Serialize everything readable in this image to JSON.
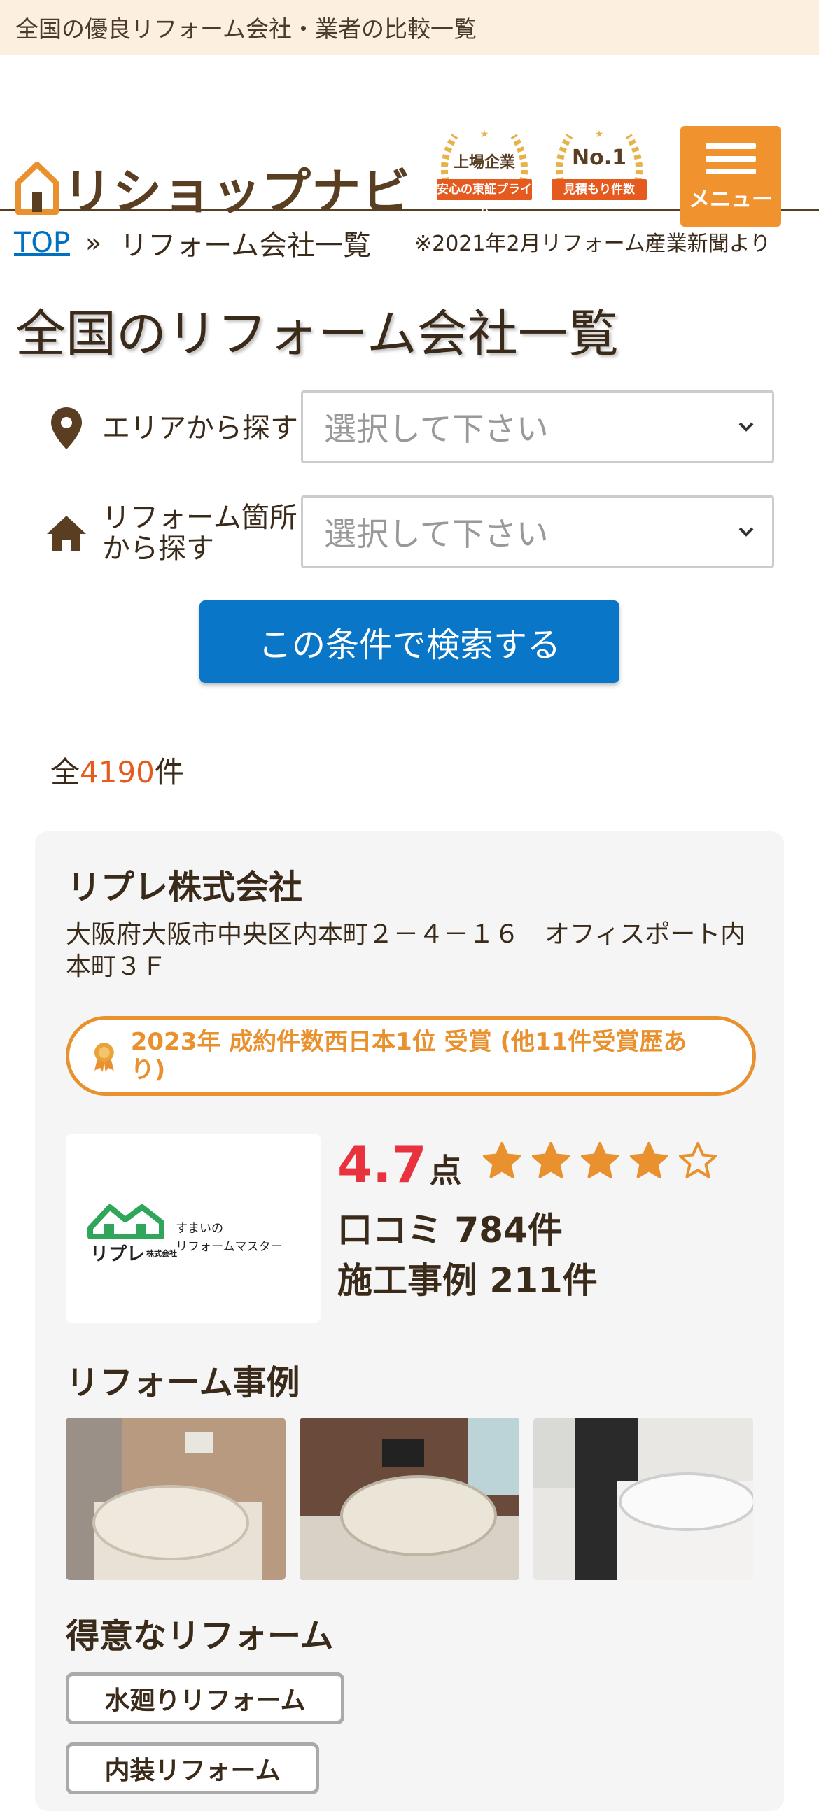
{
  "topbar": {
    "tagline": "全国の優良リフォーム会社・業者の比較一覧"
  },
  "header": {
    "logo_text": "リショップナビ",
    "award1": {
      "top": "上場企業",
      "ribbon": "安心の東証プライム"
    },
    "award2": {
      "top": "No.1",
      "ribbon": "見積もり件数"
    },
    "menu_label": "メニュー",
    "source_note": "※2021年2月リフォーム産業新聞より"
  },
  "breadcrumb": {
    "top": "TOP",
    "sep": "»",
    "current": "リフォーム会社一覧"
  },
  "page_title": "全国のリフォーム会社一覧",
  "filters": {
    "area_label": "エリアから探す",
    "area_placeholder": "選択して下さい",
    "part_label": "リフォーム箇所から探す",
    "part_placeholder": "選択して下さい",
    "search_button": "この条件で検索する"
  },
  "results": {
    "prefix": "全",
    "count": "4190",
    "suffix": "件"
  },
  "company": {
    "name": "リプレ株式会社",
    "address": "大阪府大阪市中央区内本町２－４－１６　オフィスポート内本町３Ｆ",
    "award": "2023年 成約件数西日本1位 受賞 (他11件受賞歴あり)",
    "logo_name": "リプレ",
    "logo_sub": "株式会社",
    "logo_tag1": "すまいの",
    "logo_tag2": "リフォームマスター",
    "score": "4.7",
    "score_unit": "点",
    "rating": 4,
    "rating_max": 5,
    "reviews": "口コミ 784件",
    "cases": "施工事例 211件",
    "cases_heading": "リフォーム事例",
    "specialty_heading": "得意なリフォーム",
    "tags": [
      "水廻りリフォーム",
      "内装リフォーム"
    ]
  },
  "colors": {
    "brand_brown": "#5a3e22",
    "accent_orange": "#e8912e",
    "score_red": "#e8333e",
    "link_blue": "#0070c0",
    "button_blue": "#0a76c8"
  }
}
